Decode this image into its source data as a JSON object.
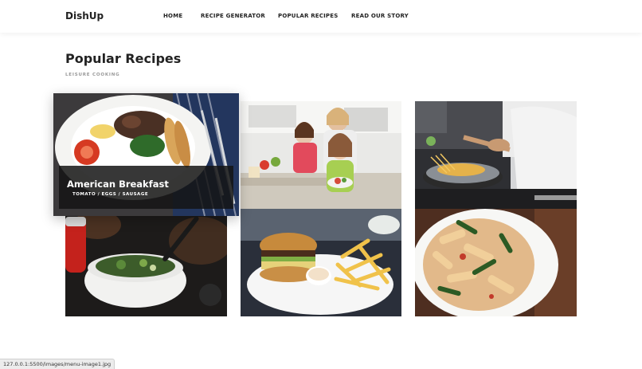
{
  "brand": "DishUp",
  "nav": {
    "items": [
      {
        "label": "HOME"
      },
      {
        "label": "RECIPE GENERATOR"
      },
      {
        "label": "POPULAR RECIPES"
      },
      {
        "label": "READ OUR STORY"
      }
    ]
  },
  "section": {
    "title": "Popular Recipes",
    "subtitle": "LEISURE COOKING"
  },
  "featured": {
    "title": "American Breakfast",
    "tags": "TOMATO / EGGS / SAUSAGE"
  },
  "status_url": "127.0.0.1:5500/images/menu-image1.jpg"
}
